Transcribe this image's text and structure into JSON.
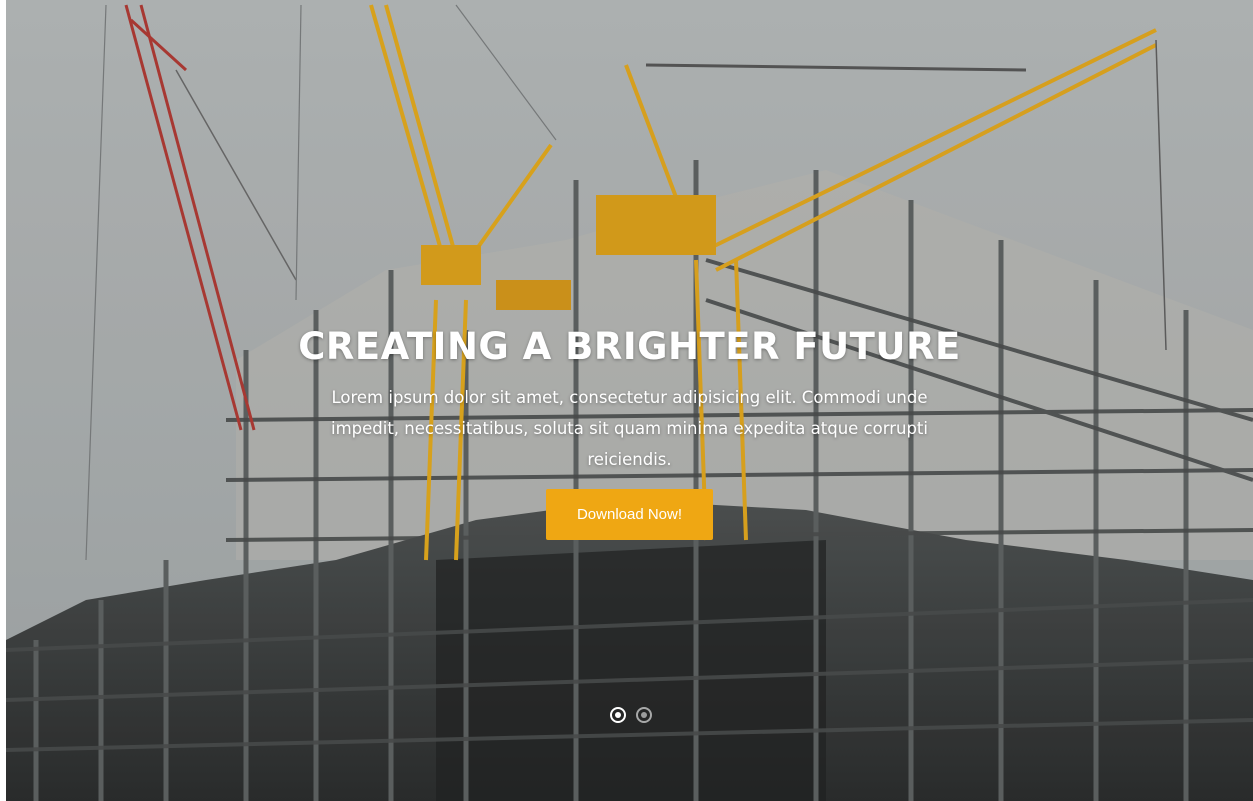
{
  "hero": {
    "title": "CREATING A BRIGHTER FUTURE",
    "description": "Lorem ipsum dolor sit amet, consectetur adipisicing elit. Commodi unde impedit, necessitatibus, soluta sit quam minima expedita atque corrupti reiciendis.",
    "cta_label": "Download Now!",
    "background_image": "construction-site-with-cranes",
    "accent_color": "#efa713"
  },
  "carousel": {
    "slide_count": 2,
    "active_index": 0
  }
}
